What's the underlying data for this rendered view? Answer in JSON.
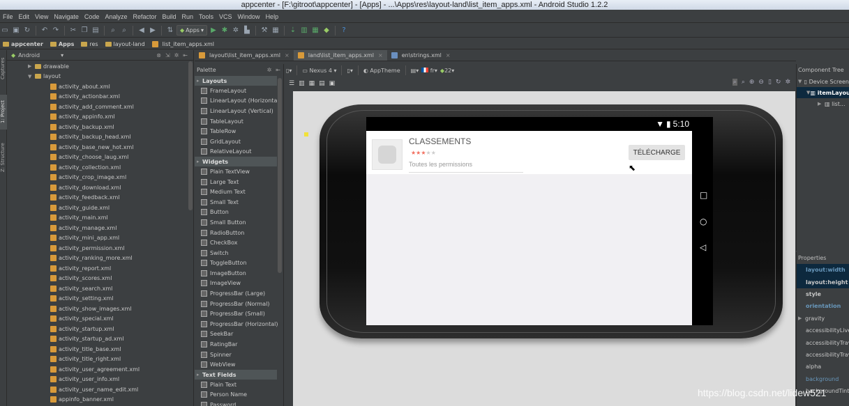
{
  "window": {
    "title": "appcenter - [F:\\gitroot\\appcenter] - [Apps] - ...\\Apps\\res\\layout-land\\list_item_apps.xml - Android Studio 1.2.2"
  },
  "menu": [
    "File",
    "Edit",
    "View",
    "Navigate",
    "Code",
    "Analyze",
    "Refactor",
    "Build",
    "Run",
    "Tools",
    "VCS",
    "Window",
    "Help"
  ],
  "toolbar": {
    "run_config": "Apps"
  },
  "breadcrumb": [
    "appcenter",
    "Apps",
    "res",
    "layout-land",
    "list_item_apps.xml"
  ],
  "side_tabs": {
    "captures": "Captures",
    "project": "1: Project",
    "structure": "Z: Structure"
  },
  "project": {
    "view_mode": "Android",
    "folders": {
      "drawable": "drawable",
      "layout": "layout"
    },
    "files": [
      "activity_about.xml",
      "activity_actionbar.xml",
      "activity_add_comment.xml",
      "activity_appinfo.xml",
      "activity_backup.xml",
      "activity_backup_head.xml",
      "activity_base_new_hot.xml",
      "activity_choose_laug.xml",
      "activity_collection.xml",
      "activity_crop_image.xml",
      "activity_download.xml",
      "activity_feedback.xml",
      "activity_guide.xml",
      "activity_main.xml",
      "activity_manage.xml",
      "activity_mini_app.xml",
      "activity_permission.xml",
      "activity_ranking_more.xml",
      "activity_report.xml",
      "activity_scores.xml",
      "activity_search.xml",
      "activity_setting.xml",
      "activity_show_images.xml",
      "activity_special.xml",
      "activity_startup.xml",
      "activity_startup_ad.xml",
      "activity_title_base.xml",
      "activity_title_right.xml",
      "activity_user_agreement.xml",
      "activity_user_info.xml",
      "activity_user_name_edit.xml",
      "appinfo_banner.xml"
    ]
  },
  "editor_tabs": [
    "layout\\list_item_apps.xml",
    "land\\list_item_apps.xml",
    "en\\strings.xml"
  ],
  "palette": {
    "title": "Palette",
    "categories": [
      {
        "name": "Layouts",
        "items": [
          "FrameLayout",
          "LinearLayout (Horizontal)",
          "LinearLayout (Vertical)",
          "TableLayout",
          "TableRow",
          "GridLayout",
          "RelativeLayout"
        ]
      },
      {
        "name": "Widgets",
        "items": [
          "Plain TextView",
          "Large Text",
          "Medium Text",
          "Small Text",
          "Button",
          "Small Button",
          "RadioButton",
          "CheckBox",
          "Switch",
          "ToggleButton",
          "ImageButton",
          "ImageView",
          "ProgressBar (Large)",
          "ProgressBar (Normal)",
          "ProgressBar (Small)",
          "ProgressBar (Horizontal)",
          "SeekBar",
          "RatingBar",
          "Spinner",
          "WebView"
        ]
      },
      {
        "name": "Text Fields",
        "items": [
          "Plain Text",
          "Person Name",
          "Password"
        ]
      }
    ]
  },
  "design_toolbar": {
    "device": "Nexus 4",
    "theme": "AppTheme",
    "locale": "fr",
    "api": "22"
  },
  "preview": {
    "time": "5:10",
    "app_title": "CLASSEMENTS",
    "rating": 3,
    "rating_max": 5,
    "permissions": "Toutes les permissions",
    "download_button": "TÉLÉCHARGE"
  },
  "component_tree": {
    "title": "Component Tree",
    "nodes": [
      "Device Screen",
      "itemLayout",
      "list..."
    ]
  },
  "properties": {
    "title": "Properties",
    "rows": [
      "layout:width",
      "layout:height",
      "style",
      "orientation",
      "gravity",
      "accessibilityLive",
      "accessibilityTrav",
      "accessibilityTrav",
      "alpha",
      "background",
      "backgroundTint"
    ]
  },
  "watermark": "https://blog.csdn.net/lidew521",
  "colors": {
    "accent_star": "#f26e5e",
    "selection": "#0d293e",
    "folder": "#c9a64d"
  }
}
